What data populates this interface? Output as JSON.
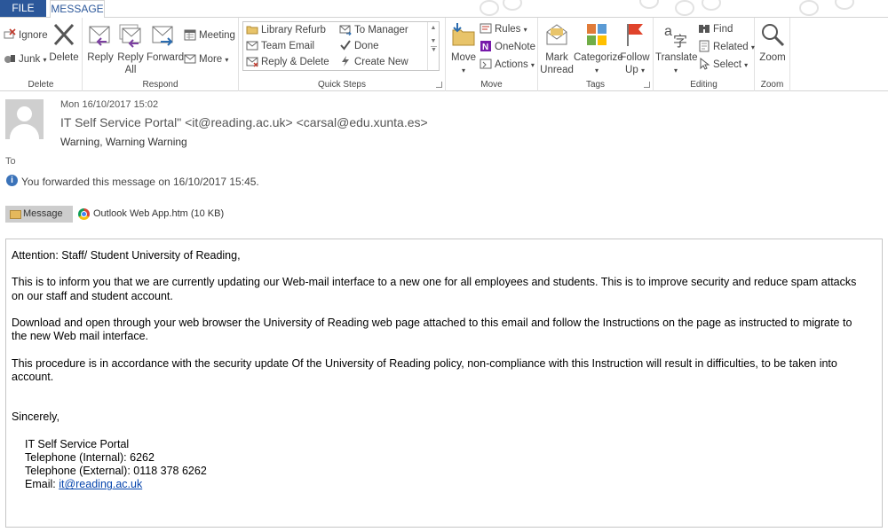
{
  "tabs": {
    "file": "FILE",
    "message": "MESSAGE"
  },
  "ribbon": {
    "delete_group": {
      "label": "Delete",
      "ignore": "Ignore",
      "junk": "Junk",
      "delete": "Delete"
    },
    "respond_group": {
      "label": "Respond",
      "reply": "Reply",
      "reply_all_1": "Reply",
      "reply_all_2": "All",
      "forward": "Forward",
      "meeting": "Meeting",
      "more": "More"
    },
    "quick_steps": {
      "label": "Quick Steps",
      "items": [
        "Library Refurb",
        "To Manager",
        "Team Email",
        "Done",
        "Reply & Delete",
        "Create New"
      ]
    },
    "move_group": {
      "label": "Move",
      "move": "Move",
      "rules": "Rules",
      "onenote": "OneNote",
      "actions": "Actions"
    },
    "tags_group": {
      "label": "Tags",
      "mark_unread_1": "Mark",
      "mark_unread_2": "Unread",
      "categorize": "Categorize",
      "follow_up_1": "Follow",
      "follow_up_2": "Up"
    },
    "editing_group": {
      "label": "Editing",
      "translate": "Translate",
      "find": "Find",
      "related": "Related",
      "select": "Select"
    },
    "zoom_group": {
      "label": "Zoom",
      "zoom": "Zoom"
    }
  },
  "email": {
    "date": "Mon 16/10/2017 15:02",
    "sender": "IT Self Service Portal\" <it@reading.ac.uk> <carsal@edu.xunta.es>",
    "subject": "Warning, Warning Warning",
    "to_label": "To",
    "info": "You forwarded this message on 16/10/2017 15:45.",
    "attachments": {
      "message": "Message",
      "file": "Outlook Web App.htm (10 KB)"
    },
    "body": {
      "greeting": "Attention: Staff/ Student University of Reading,",
      "p1": "This is to inform you that we are currently updating our Web-mail interface to a new one for all employees and students. This is to improve security and reduce spam attacks on our staff and student account.",
      "p2": "Download and open through your web browser the University of Reading web page attached to this email and follow the Instructions on the page as instructed to migrate to the new Web mail interface.",
      "p3": "This procedure is in accordance with the security update Of the University of Reading policy, non-compliance with this Instruction will result in difficulties, to be taken into account.",
      "closing": "Sincerely,",
      "sig_name": "IT Self Service Portal",
      "sig_tel_int": "Telephone (Internal): 6262",
      "sig_tel_ext": "Telephone (External): 0118 378 6262",
      "sig_email_label": "Email: ",
      "sig_email": "it@reading.ac.uk"
    }
  },
  "colors": {
    "accent": "#2b579a",
    "link": "#0645ad"
  }
}
